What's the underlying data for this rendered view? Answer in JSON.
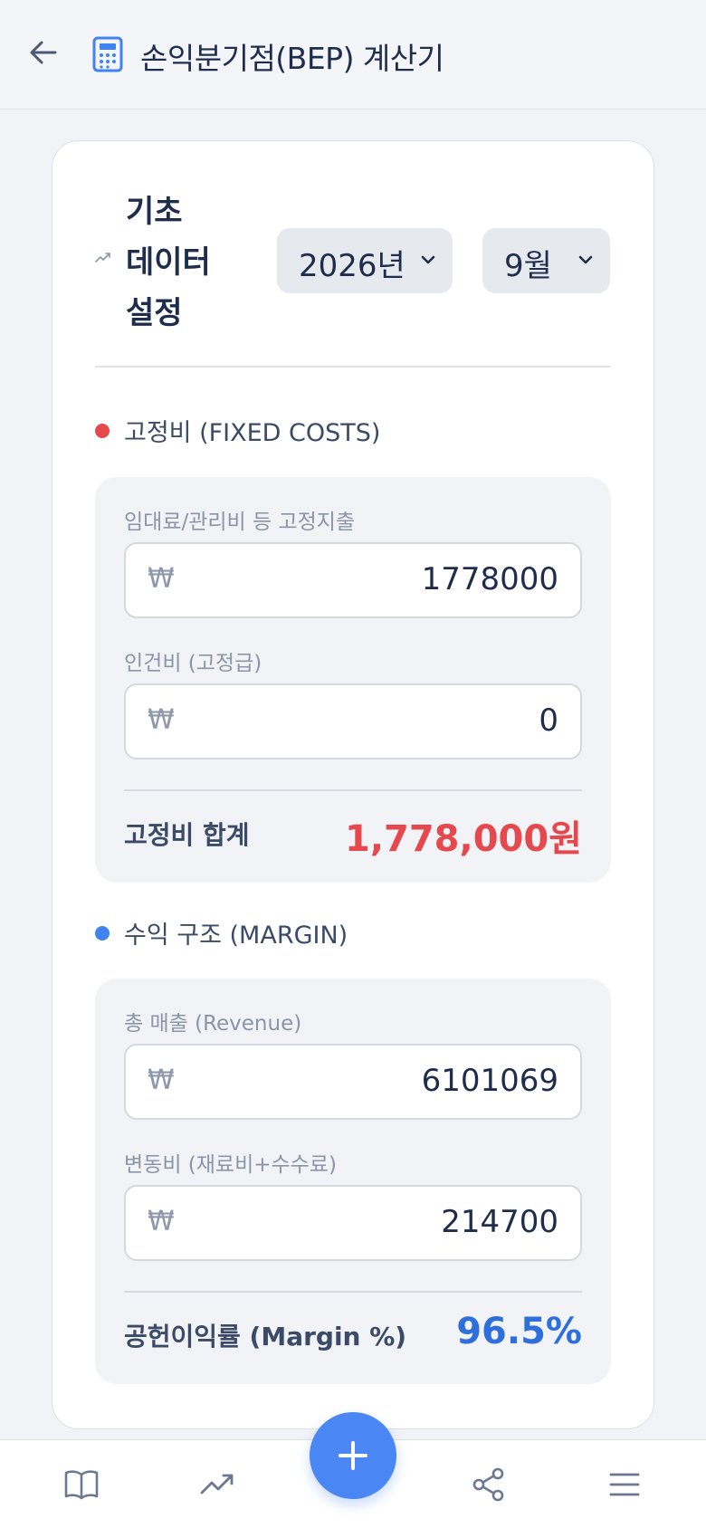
{
  "header": {
    "title": "손익분기점(BEP) 계산기",
    "back_icon": "arrow-left-icon",
    "app_icon": "calculator-icon"
  },
  "setup": {
    "heading_lines": [
      "기초",
      "데이터",
      "설정"
    ],
    "year": "2026년",
    "month": "9월"
  },
  "fixed_costs": {
    "title": "고정비 (FIXED COSTS)",
    "dot_color": "#e5484d",
    "rent_label": "임대료/관리비 등 고정지출",
    "rent_value": "1778000",
    "labor_label": "인건비 (고정급)",
    "labor_value": "0",
    "currency_symbol": "₩",
    "total_label": "고정비 합계",
    "total_value": "1,778,000원",
    "total_color": "#e5484d"
  },
  "margin": {
    "title": "수익 구조 (MARGIN)",
    "dot_color": "#3f82f0",
    "revenue_label": "총 매출 (Revenue)",
    "revenue_value": "6101069",
    "variable_label": "변동비 (재료비+수수료)",
    "variable_value": "214700",
    "currency_symbol": "₩",
    "rate_label": "공헌이익률 (Margin %)",
    "rate_value": "96.5%",
    "rate_color": "#2f6fdc"
  },
  "bottom_nav": {
    "items": [
      "book-icon",
      "trending-up-icon",
      "plus-icon",
      "share-icon",
      "menu-icon"
    ],
    "fab_color": "#4a86f4"
  }
}
